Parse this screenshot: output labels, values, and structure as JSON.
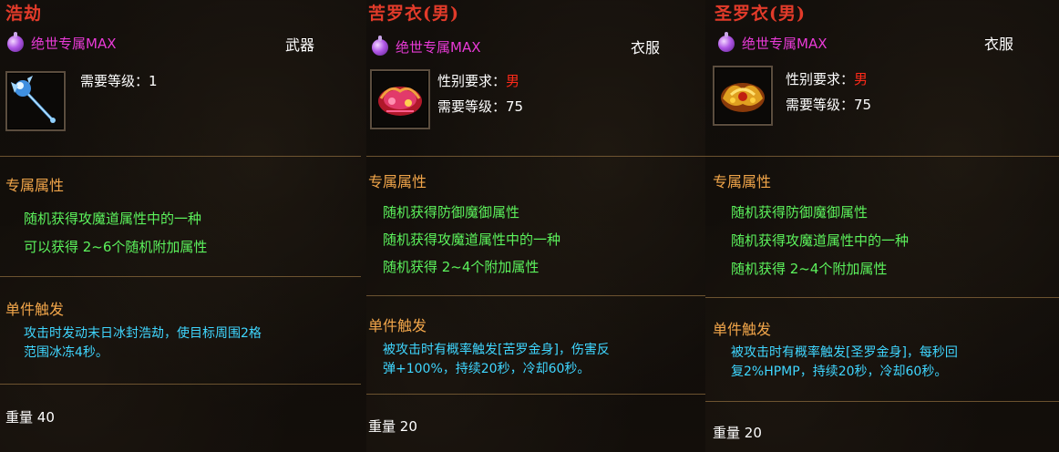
{
  "panels": [
    {
      "title": "浩劫",
      "grade": "绝世专属MAX",
      "type": "武器",
      "icon": "ice-staff-icon",
      "stats": [
        {
          "label": "需要等级：",
          "value": "1"
        }
      ],
      "section1_title": "专属属性",
      "attrs": [
        "随机获得攻魔道属性中的一种",
        "可以获得 2~6个随机附加属性"
      ],
      "section2_title": "单件触发",
      "effect_lines": [
        "攻击时发动末日冰封浩劫，使目标周围2格",
        "范围冰冻4秒。"
      ],
      "weight_label": "重量",
      "weight_value": "40"
    },
    {
      "title": "苦罗衣(男)",
      "grade": "绝世专属MAX",
      "type": "衣服",
      "icon": "red-armor-icon",
      "stats": [
        {
          "label": "性别要求：",
          "value": "男"
        },
        {
          "label": "需要等级：",
          "value": "75"
        }
      ],
      "section1_title": "专属属性",
      "attrs": [
        "随机获得防御魔御属性",
        "随机获得攻魔道属性中的一种",
        "随机获得 2~4个附加属性"
      ],
      "section2_title": "单件触发",
      "effect_lines": [
        "被攻击时有概率触发[苦罗金身]，伤害反",
        "弹+100%，持续20秒，冷却60秒。"
      ],
      "weight_label": "重量",
      "weight_value": "20"
    },
    {
      "title": "圣罗衣(男)",
      "grade": "绝世专属MAX",
      "type": "衣服",
      "icon": "gold-armor-icon",
      "stats": [
        {
          "label": "性别要求：",
          "value": "男"
        },
        {
          "label": "需要等级：",
          "value": "75"
        }
      ],
      "section1_title": "专属属性",
      "attrs": [
        "随机获得防御魔御属性",
        "随机获得攻魔道属性中的一种",
        "随机获得 2~4个附加属性"
      ],
      "section2_title": "单件触发",
      "effect_lines": [
        "被攻击时有概率触发[圣罗金身]，每秒回",
        "复2%HPMP，持续20秒，冷却60秒。"
      ],
      "weight_label": "重量",
      "weight_value": "20"
    }
  ],
  "colors": {
    "title": "#e23b2a",
    "grade": "#e83ad6",
    "section": "#f2a64a",
    "attr": "#5cf25c",
    "effect": "#3fd6ff",
    "gender": "#ff2a1a"
  }
}
